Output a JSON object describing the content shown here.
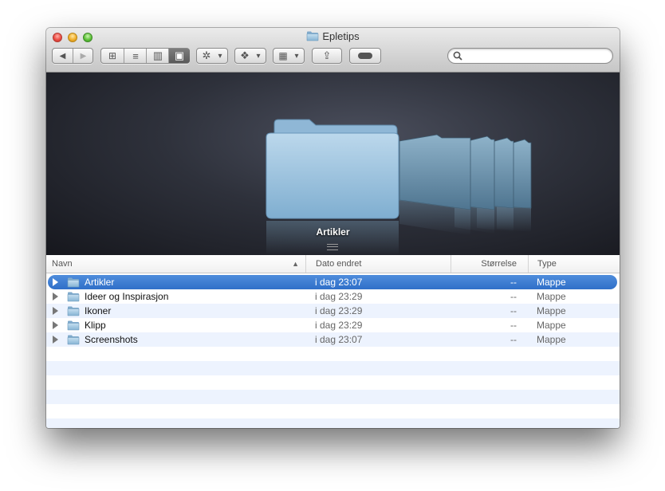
{
  "window": {
    "title": "Epletips"
  },
  "toolbar": {
    "back": "◀",
    "forward": "▶",
    "view_icon": "⊞",
    "view_list": "≡",
    "view_columns": "▥",
    "view_coverflow": "▣",
    "action_menu": "✲",
    "dropbox_menu": "❖",
    "arrange_menu": "▦",
    "share": "⇪",
    "tag": "●",
    "dropdown_caret": "▾"
  },
  "search": {
    "placeholder": "",
    "icon": "magnifier-icon"
  },
  "coverflow": {
    "selected_label": "Artikler"
  },
  "columns": {
    "name": "Navn",
    "sort_indicator": "▲",
    "date": "Dato endret",
    "size": "Størrelse",
    "kind": "Type"
  },
  "files": [
    {
      "name": "Artikler",
      "date": "i dag 23:07",
      "size": "--",
      "kind": "Mappe",
      "selected": true
    },
    {
      "name": "Ideer og Inspirasjon",
      "date": "i dag 23:29",
      "size": "--",
      "kind": "Mappe",
      "selected": false
    },
    {
      "name": "Ikoner",
      "date": "i dag 23:29",
      "size": "--",
      "kind": "Mappe",
      "selected": false
    },
    {
      "name": "Klipp",
      "date": "i dag 23:29",
      "size": "--",
      "kind": "Mappe",
      "selected": false
    },
    {
      "name": "Screenshots",
      "date": "i dag 23:07",
      "size": "--",
      "kind": "Mappe",
      "selected": false
    }
  ],
  "colors": {
    "selection": "#3a78d0",
    "folder": "#9cc1dc",
    "stripe": "#edf3fe"
  }
}
